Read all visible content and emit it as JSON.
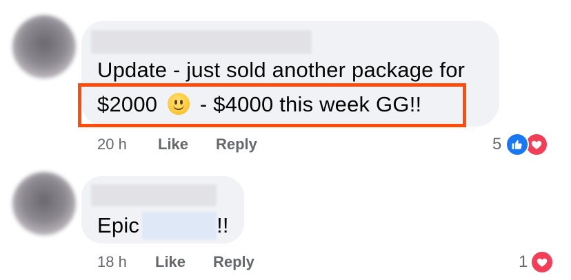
{
  "comments": [
    {
      "text_line1": "Update - just sold another package for",
      "amount": "$2000",
      "text_line2_rest": "- $4000 this week GG!!",
      "time": "20 h",
      "like_label": "Like",
      "reply_label": "Reply",
      "reaction_count": "5",
      "reactions": [
        "like-icon",
        "love-icon"
      ]
    },
    {
      "text_before": "Epic",
      "text_after": "!!",
      "time": "18 h",
      "like_label": "Like",
      "reply_label": "Reply",
      "reaction_count": "1",
      "reactions": [
        "love-icon"
      ]
    }
  ],
  "colors": {
    "highlight": "#ff4c0a",
    "bubble": "#f0f2f5",
    "like": "#1877f2",
    "love": "#f33e58",
    "meta_text": "#65676b"
  }
}
